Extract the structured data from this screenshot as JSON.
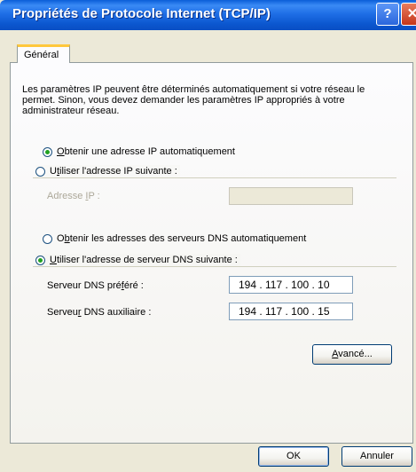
{
  "window": {
    "title": "Propriétés de Protocole Internet (TCP/IP)",
    "help": "?",
    "close": "✕"
  },
  "tab": {
    "label": "Général"
  },
  "description": "Les paramètres IP peuvent être déterminés automatiquement si votre réseau le permet. Sinon, vous devez demander les paramètres IP appropriés à votre administrateur réseau.",
  "ip": {
    "auto_pre": "",
    "auto_key": "O",
    "auto_post": "btenir une adresse IP automatiquement",
    "manual_pre": "U",
    "manual_key": "t",
    "manual_post": "iliser l'adresse IP suivante :",
    "address_pre": "Adresse ",
    "address_key": "I",
    "address_post": "P :",
    "address_value": ""
  },
  "dns": {
    "auto_pre": "O",
    "auto_key": "b",
    "auto_post": "tenir les adresses des serveurs DNS automatiquement",
    "manual_pre": "",
    "manual_key": "U",
    "manual_post": "tiliser l'adresse de serveur DNS suivante :",
    "preferred_pre": "Serveur DNS pré",
    "preferred_key": "f",
    "preferred_post": "éré :",
    "preferred_value": "194 . 117 . 100 . 10",
    "alternate_pre": "Serveu",
    "alternate_key": "r",
    "alternate_post": " DNS auxiliaire :",
    "alternate_value": "194 . 117 . 100 . 15"
  },
  "buttons": {
    "advanced_pre": "",
    "advanced_key": "A",
    "advanced_post": "vancé...",
    "ok": "OK",
    "cancel": "Annuler"
  }
}
